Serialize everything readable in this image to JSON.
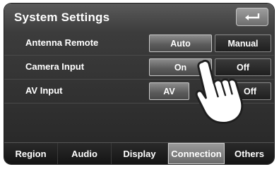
{
  "title": "System Settings",
  "back_icon": "return-arrow-icon",
  "settings": [
    {
      "label": "Antenna Remote",
      "options": [
        "Auto",
        "Manual"
      ],
      "selected": "Auto"
    },
    {
      "label": "Camera Input",
      "options": [
        "On",
        "Off"
      ],
      "selected": "On"
    },
    {
      "label": "AV Input",
      "options": [
        "AV",
        "Off"
      ],
      "selected": "AV"
    }
  ],
  "tabs": [
    "Region",
    "Audio",
    "Display",
    "Connection",
    "Others"
  ],
  "active_tab": "Connection",
  "pointer_icon": "pointing-hand-icon"
}
